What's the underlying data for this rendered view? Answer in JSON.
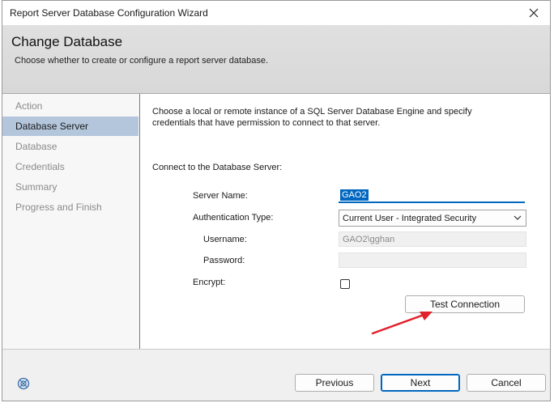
{
  "window": {
    "title": "Report Server Database Configuration Wizard"
  },
  "banner": {
    "heading": "Change Database",
    "subheading": "Choose whether to create or configure a report server database."
  },
  "nav": {
    "items": [
      {
        "label": "Action",
        "active": false
      },
      {
        "label": "Database Server",
        "active": true
      },
      {
        "label": "Database",
        "active": false
      },
      {
        "label": "Credentials",
        "active": false
      },
      {
        "label": "Summary",
        "active": false
      },
      {
        "label": "Progress and Finish",
        "active": false
      }
    ]
  },
  "content": {
    "description": "Choose a local or remote instance of a SQL Server Database Engine and specify credentials that have permission to connect to that server.",
    "connect_heading": "Connect to the Database Server:",
    "server_name_label": "Server Name:",
    "server_name_value": "GAO2",
    "auth_type_label": "Authentication Type:",
    "auth_type_value": "Current User - Integrated Security",
    "username_label": "Username:",
    "username_value": "GAO2\\gghan",
    "password_label": "Password:",
    "password_value": "",
    "encrypt_label": "Encrypt:",
    "encrypt_checked": false,
    "test_connection_label": "Test Connection"
  },
  "footer": {
    "previous_label": "Previous",
    "next_label": "Next",
    "cancel_label": "Cancel"
  },
  "colors": {
    "selection": "#0067c0",
    "nav_active": "#b4c6dc",
    "annotation_arrow": "#e0202a"
  },
  "icons": {
    "close": "close-icon",
    "dropdown": "chevron-down-icon",
    "help": "help-icon"
  }
}
